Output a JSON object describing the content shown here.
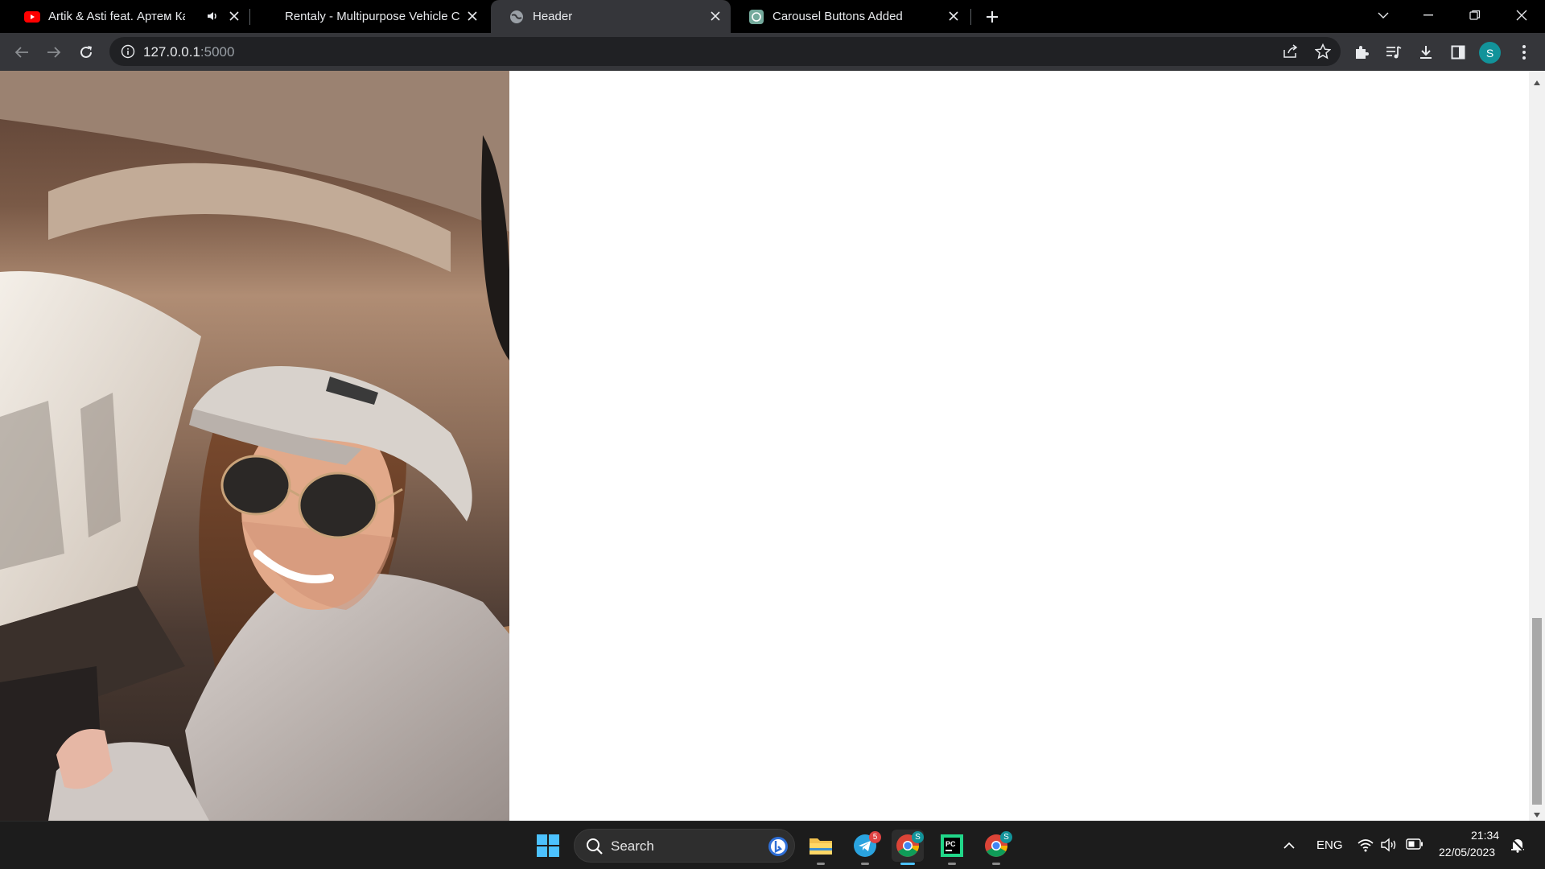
{
  "browser": {
    "tabs": [
      {
        "title": "Artik & Asti feat. Артем Каче",
        "favicon": "youtube-icon",
        "audio": true,
        "active": false
      },
      {
        "title": "Rentaly - Multipurpose Vehicle C",
        "favicon": "none",
        "active": false
      },
      {
        "title": "Header",
        "favicon": "globe-icon",
        "active": true
      },
      {
        "title": "Carousel Buttons Added",
        "favicon": "chatgpt-icon",
        "active": false
      }
    ],
    "url_host": "127.0.0.1",
    "url_port": ":5000",
    "profile_initial": "S"
  },
  "page": {
    "image_alt": "woman in white cap and sunglasses smiling in car"
  },
  "taskbar": {
    "search_label": "Search",
    "telegram_badge": "5",
    "chrome_profile_badge": "S",
    "language": "ENG",
    "time": "21:34",
    "date": "22/05/2023"
  },
  "colors": {
    "tabstrip": "#000000",
    "toolbar": "#35363a",
    "page_bg": "#ffffff",
    "taskbar": "#1c1c1c",
    "accent": "#4cc2ff"
  }
}
